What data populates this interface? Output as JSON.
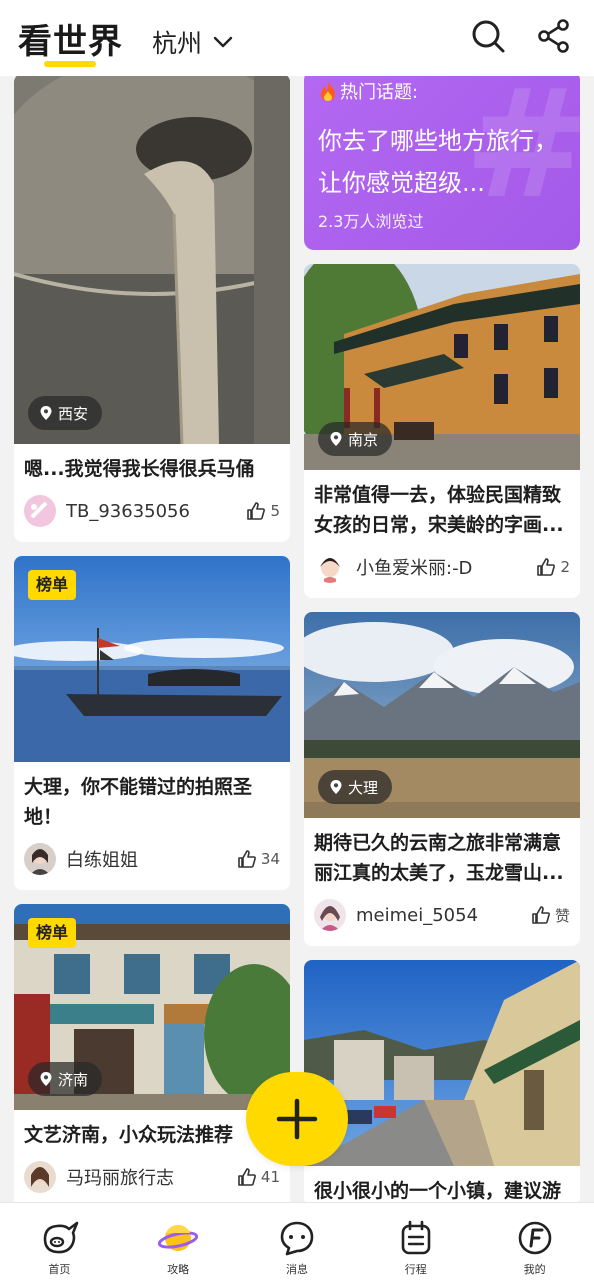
{
  "header": {
    "title": "看世界",
    "city": "杭州"
  },
  "feed": {
    "left": [
      {
        "location": "西安",
        "title": "嗯...我觉得我长得很兵马俑",
        "author": "TB_93635056",
        "likes": "5"
      },
      {
        "badge": "榜单",
        "title": "大理，你不能错过的拍照圣地！",
        "author": "白练姐姐",
        "likes": "34"
      },
      {
        "badge": "榜单",
        "location": "济南",
        "title": "文艺济南，小众玩法推荐",
        "author": "马玛丽旅行志",
        "likes": "41"
      }
    ],
    "topic": {
      "label": "热门话题:",
      "text": "你去了哪些地方旅行，让你感觉超级...",
      "views": "2.3万人浏览过"
    },
    "right": [
      {
        "location": "南京",
        "title": "非常值得一去，体验民国精致女孩的日常，宋美龄的字画...",
        "author": "小鱼爱米丽:-D",
        "likes": "2"
      },
      {
        "location": "大理",
        "title": "期待已久的云南之旅非常满意丽江真的太美了，玉龙雪山...",
        "author": "meimei_5054",
        "likes": "赞"
      },
      {
        "title": "很小很小的一个小镇，建议游"
      }
    ]
  },
  "tabbar": {
    "items": [
      {
        "label": "首页",
        "icon": "home-pig-icon"
      },
      {
        "label": "攻略",
        "icon": "planet-icon"
      },
      {
        "label": "消息",
        "icon": "message-icon"
      },
      {
        "label": "行程",
        "icon": "itinerary-icon"
      },
      {
        "label": "我的",
        "icon": "profile-icon"
      }
    ]
  },
  "colors": {
    "accent": "#ffd900",
    "topic_purple": "#b468f2"
  }
}
